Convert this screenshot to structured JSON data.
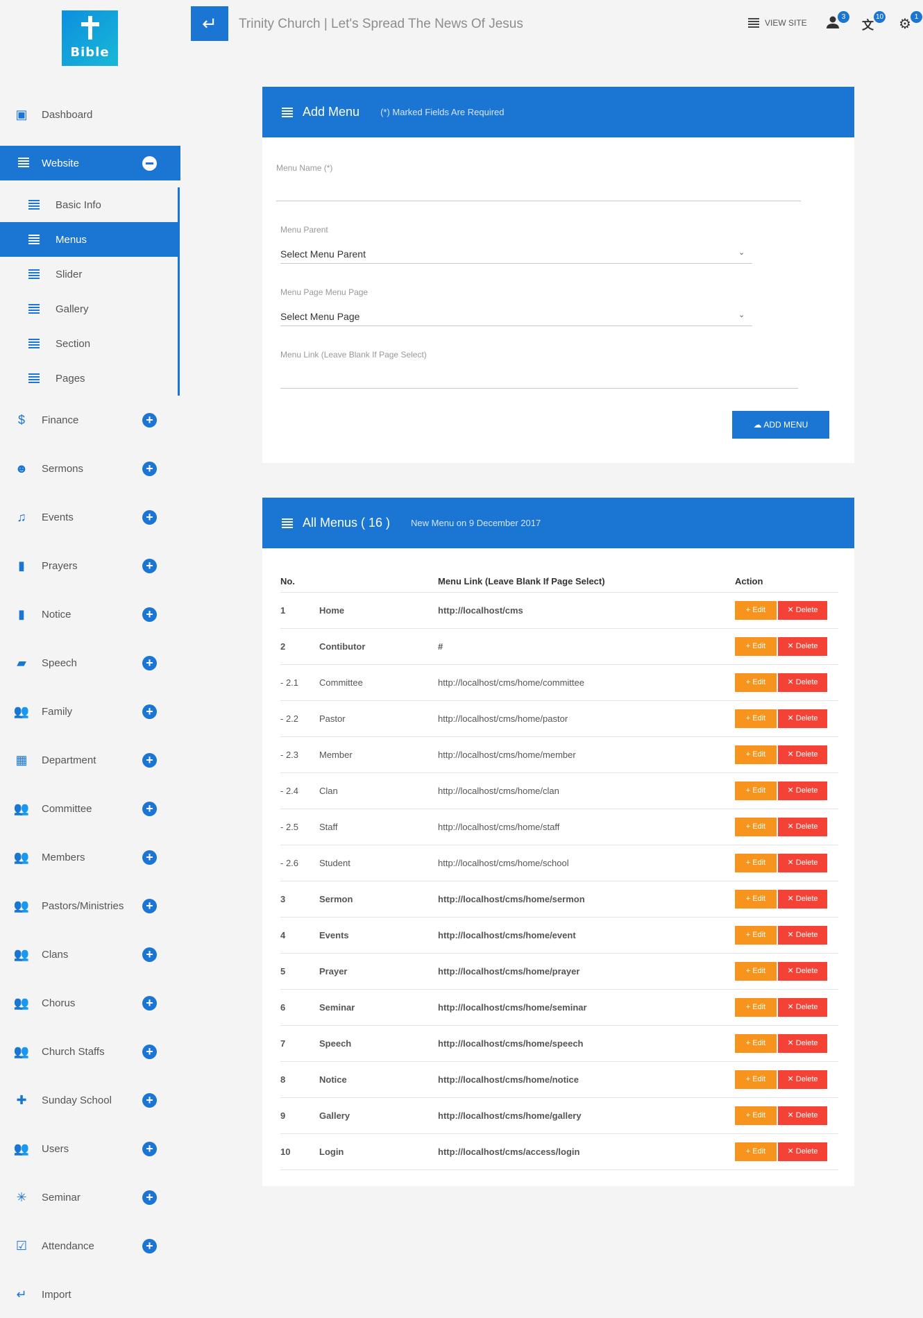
{
  "header": {
    "logo_text": "Bible",
    "title": "Trinity Church | Let's Spread The News Of Jesus",
    "view_site": "VIEW SITE",
    "badges": {
      "user": "3",
      "translate": "10",
      "settings": "1"
    }
  },
  "sidebar": {
    "items": [
      {
        "label": "Dashboard",
        "icon": "dashboard-icon"
      },
      {
        "label": "Website",
        "icon": "list-icon",
        "active": true
      },
      {
        "label": "Finance",
        "icon": "dollar-icon"
      },
      {
        "label": "Sermons",
        "icon": "voice-icon"
      },
      {
        "label": "Events",
        "icon": "bell-icon"
      },
      {
        "label": "Prayers",
        "icon": "bookmark-icon"
      },
      {
        "label": "Notice",
        "icon": "bookmark-icon"
      },
      {
        "label": "Speech",
        "icon": "chat-icon"
      },
      {
        "label": "Family",
        "icon": "people-icon"
      },
      {
        "label": "Department",
        "icon": "grid-icon"
      },
      {
        "label": "Committee",
        "icon": "people-icon"
      },
      {
        "label": "Members",
        "icon": "people-icon"
      },
      {
        "label": "Pastors/Ministries",
        "icon": "people-icon"
      },
      {
        "label": "Clans",
        "icon": "people-icon"
      },
      {
        "label": "Chorus",
        "icon": "people-icon"
      },
      {
        "label": "Church Staffs",
        "icon": "people-icon"
      },
      {
        "label": "Sunday School",
        "icon": "gamepad-icon"
      },
      {
        "label": "Users",
        "icon": "people-icon"
      },
      {
        "label": "Seminar",
        "icon": "spark-icon"
      },
      {
        "label": "Attendance",
        "icon": "clipboard-check-icon"
      },
      {
        "label": "Import",
        "icon": "enter-icon"
      }
    ],
    "website_sub": [
      {
        "label": "Basic Info"
      },
      {
        "label": "Menus",
        "active": true
      },
      {
        "label": "Slider"
      },
      {
        "label": "Gallery"
      },
      {
        "label": "Section"
      },
      {
        "label": "Pages"
      }
    ]
  },
  "add_menu": {
    "title": "Add Menu",
    "note": "(*) Marked Fields Are Required",
    "menu_name_label": "Menu Name (*)",
    "menu_parent_label": "Menu Parent",
    "menu_parent_value": "Select Menu Parent",
    "menu_page_label": "Menu Page Menu Page",
    "menu_page_value": "Select Menu Page",
    "menu_link_label": "Menu Link (Leave Blank If Page Select)",
    "button": "ADD MENU"
  },
  "all_menus": {
    "title": "All Menus ( 16 )",
    "note": "New Menu on 9 December 2017",
    "columns": [
      "No.",
      "",
      "Menu Link (Leave Blank If Page Select)",
      "Action"
    ],
    "edit_label": "Edit",
    "delete_label": "Delete",
    "rows": [
      {
        "no": "1",
        "name": "Home",
        "link": "http://localhost/cms",
        "bold": true
      },
      {
        "no": "2",
        "name": "Contibutor",
        "link": "#",
        "bold": true
      },
      {
        "no": "- 2.1",
        "name": "Committee",
        "link": "http://localhost/cms/home/committee",
        "bold": false
      },
      {
        "no": "- 2.2",
        "name": "Pastor",
        "link": "http://localhost/cms/home/pastor",
        "bold": false
      },
      {
        "no": "- 2.3",
        "name": "Member",
        "link": "http://localhost/cms/home/member",
        "bold": false
      },
      {
        "no": "- 2.4",
        "name": "Clan",
        "link": "http://localhost/cms/home/clan",
        "bold": false
      },
      {
        "no": "- 2.5",
        "name": "Staff",
        "link": "http://localhost/cms/home/staff",
        "bold": false
      },
      {
        "no": "- 2.6",
        "name": "Student",
        "link": "http://localhost/cms/home/school",
        "bold": false
      },
      {
        "no": "3",
        "name": "Sermon",
        "link": "http://localhost/cms/home/sermon",
        "bold": true
      },
      {
        "no": "4",
        "name": "Events",
        "link": "http://localhost/cms/home/event",
        "bold": true
      },
      {
        "no": "5",
        "name": "Prayer",
        "link": "http://localhost/cms/home/prayer",
        "bold": true
      },
      {
        "no": "6",
        "name": "Seminar",
        "link": "http://localhost/cms/home/seminar",
        "bold": true
      },
      {
        "no": "7",
        "name": "Speech",
        "link": "http://localhost/cms/home/speech",
        "bold": true
      },
      {
        "no": "8",
        "name": "Notice",
        "link": "http://localhost/cms/home/notice",
        "bold": true
      },
      {
        "no": "9",
        "name": "Gallery",
        "link": "http://localhost/cms/home/gallery",
        "bold": true
      },
      {
        "no": "10",
        "name": "Login",
        "link": "http://localhost/cms/access/login",
        "bold": true
      }
    ]
  }
}
